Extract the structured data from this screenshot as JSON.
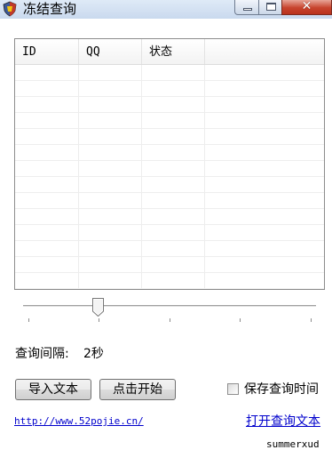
{
  "window": {
    "title": "冻结查询",
    "close_glyph": "✕"
  },
  "list": {
    "columns": [
      "ID",
      "QQ",
      "状态",
      ""
    ]
  },
  "slider": {
    "ticks": 5,
    "position_fraction": 0.25
  },
  "interval": {
    "label": "查询间隔:",
    "value": "2秒"
  },
  "buttons": {
    "import_label": "导入文本",
    "start_label": "点击开始"
  },
  "checkbox": {
    "label": "保存查询时间",
    "checked": false
  },
  "links": {
    "url": "http://www.52pojie.cn/",
    "open_text": "打开查询文本"
  },
  "footer": {
    "author": "summerxud"
  },
  "colors": {
    "link": "#0000cc",
    "titlebar": "#dfeaf7",
    "close_button": "#c7432d"
  }
}
